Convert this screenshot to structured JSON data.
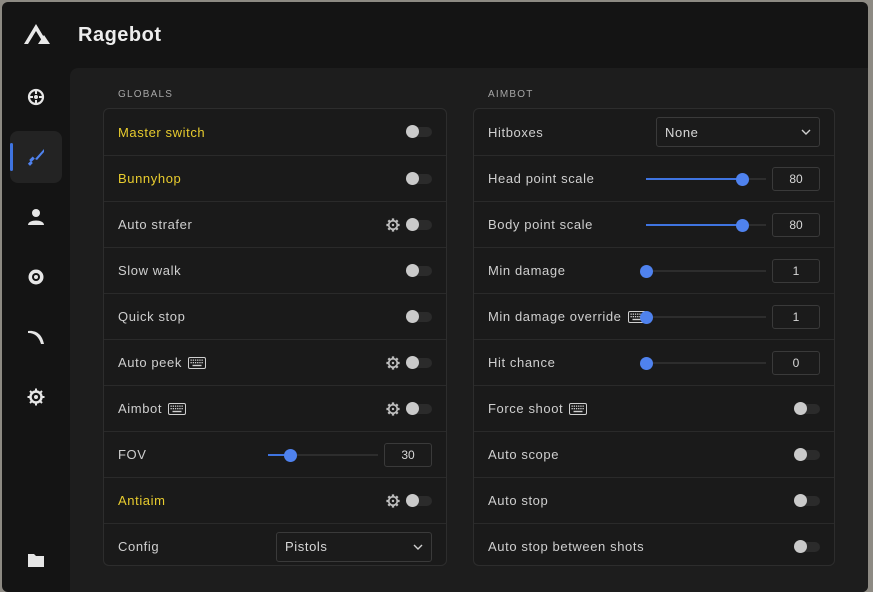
{
  "app": {
    "title": "Ragebot"
  },
  "sidebar": {
    "items": [
      {
        "icon": "crosshair-icon",
        "active": false
      },
      {
        "icon": "knife-icon",
        "active": true
      },
      {
        "icon": "user-icon",
        "active": false
      },
      {
        "icon": "eye-icon",
        "active": false
      },
      {
        "icon": "swoosh-icon",
        "active": false
      },
      {
        "icon": "gear-icon",
        "active": false
      },
      {
        "icon": "folder-icon",
        "active": false
      }
    ]
  },
  "globals": {
    "label": "GLOBALS",
    "rows": [
      {
        "label": "Master switch",
        "highlight": true,
        "toggle": false
      },
      {
        "label": "Bunnyhop",
        "highlight": true,
        "toggle": false
      },
      {
        "label": "Auto strafer",
        "gear": true,
        "toggle": false
      },
      {
        "label": "Slow walk",
        "toggle": false
      },
      {
        "label": "Quick stop",
        "toggle": false
      },
      {
        "label": "Auto peek",
        "keybind": true,
        "gear": true,
        "toggle": false
      },
      {
        "label": "Aimbot",
        "keybind": true,
        "gear": true,
        "toggle": false
      },
      {
        "label": "FOV",
        "slider": {
          "value": "30",
          "fraction": 0.2
        }
      },
      {
        "label": "Antiaim",
        "highlight": true,
        "gear": true,
        "toggle": false
      },
      {
        "label": "Config",
        "select": "Pistols"
      }
    ]
  },
  "aimbot": {
    "label": "AIMBOT",
    "rows": [
      {
        "label": "Hitboxes",
        "select": "None"
      },
      {
        "label": "Head point scale",
        "slider": {
          "value": "80",
          "fraction": 0.8
        }
      },
      {
        "label": "Body point scale",
        "slider": {
          "value": "80",
          "fraction": 0.8
        }
      },
      {
        "label": "Min damage",
        "slider": {
          "value": "1",
          "fraction": 0.0
        }
      },
      {
        "label": "Min damage override",
        "keybind": true,
        "slider": {
          "value": "1",
          "fraction": 0.0
        }
      },
      {
        "label": "Hit chance",
        "slider": {
          "value": "0",
          "fraction": 0.0
        }
      },
      {
        "label": "Force shoot",
        "keybind": true,
        "toggle": false
      },
      {
        "label": "Auto scope",
        "toggle": false
      },
      {
        "label": "Auto stop",
        "toggle": false
      },
      {
        "label": "Auto stop between shots",
        "toggle": false
      }
    ]
  },
  "colors": {
    "accent": "#3f74e0",
    "highlight": "#e8cc2e"
  }
}
